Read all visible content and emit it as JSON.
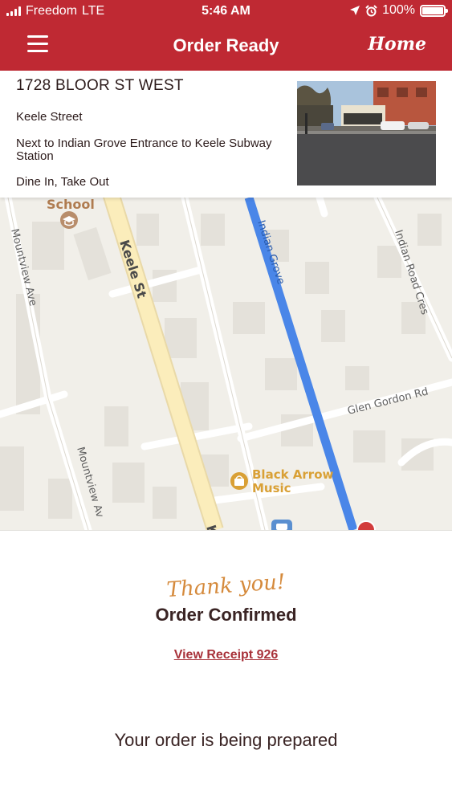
{
  "status_bar": {
    "carrier": "Freedom",
    "network": "LTE",
    "time": "5:46 AM",
    "battery": "100%",
    "battery_level": 1.0,
    "icons": [
      "signal-icon",
      "location-arrow-icon",
      "alarm-icon",
      "battery-icon"
    ]
  },
  "header": {
    "title": "Order Ready",
    "home_label": "Home",
    "background_color": "#bf2933"
  },
  "store": {
    "address": "1728 BLOOR ST WEST",
    "street": "Keele Street",
    "location_note": "Next to Indian Grove Entrance to Keele Subway Station",
    "service_types": "Dine In, Take Out"
  },
  "map": {
    "labels": {
      "school": "School",
      "mountview_top": "Mountview Ave",
      "mountview_bottom": "Mountview Av",
      "keele": "Keele St",
      "keele_cut": "K",
      "indian_grove": "Indian Grove",
      "indian_road": "Indian Road Cres",
      "glen_gordon": "Glen Gordon Rd",
      "black_arrow_1": "Black Arrow",
      "black_arrow_2": "Music"
    },
    "route_color": "#4a86e8",
    "poi_color": "#d9a035"
  },
  "confirmation": {
    "thank_you": "Thank you!",
    "status": "Order Confirmed",
    "receipt_link": "View Receipt 926",
    "progress_message": "Your order is being prepared",
    "accent_color": "#d58a3c",
    "link_color": "#a8323a"
  }
}
